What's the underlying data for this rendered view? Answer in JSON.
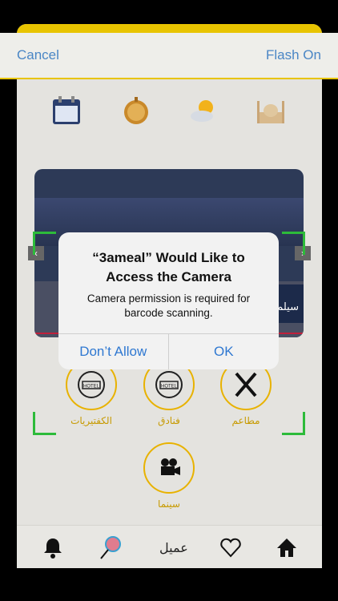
{
  "scanner": {
    "cancel_label": "Cancel",
    "flash_label": "Flash On"
  },
  "top_icons": [
    "calendar-icon",
    "compass-icon",
    "weather-icon",
    "mosque-icon"
  ],
  "banner": {
    "ad_text": "سيلم"
  },
  "categories": [
    {
      "label": "الكفتيريات",
      "icon": "hotel-icon"
    },
    {
      "label": "فنادق",
      "icon": "hotel-icon"
    },
    {
      "label": "مطاعم",
      "icon": "fork-knife-icon"
    },
    {
      "label": "سينما",
      "icon": "camera-icon"
    }
  ],
  "tabbar": {
    "middle_text": "عميل",
    "icons": [
      "bell-icon",
      "lollipop-icon",
      "heart-icon",
      "home-icon"
    ]
  },
  "alert": {
    "title": "“3ameal” Would Like to Access the Camera",
    "message": "Camera permission is required for barcode scanning.",
    "deny_label": "Don’t Allow",
    "allow_label": "OK"
  },
  "colors": {
    "accent_yellow": "#e8c400",
    "link_blue": "#2f78d1",
    "scan_corner_green": "#2dbb3a"
  }
}
